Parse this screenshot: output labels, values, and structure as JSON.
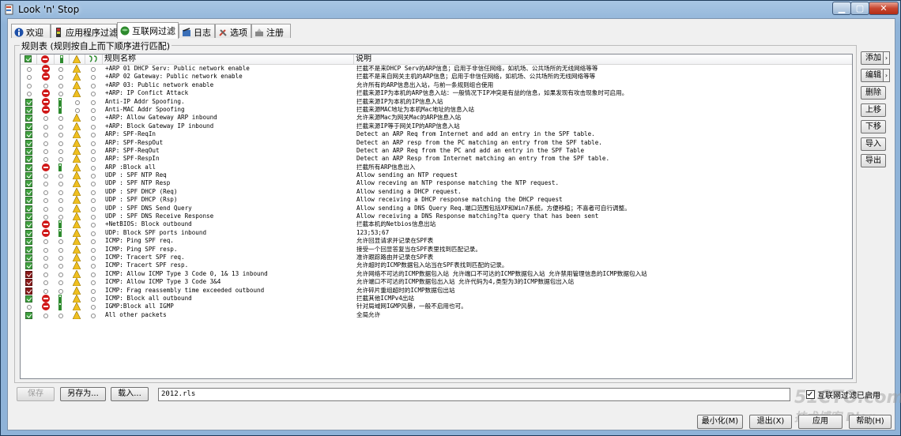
{
  "window": {
    "title": "Look 'n' Stop"
  },
  "tabs": [
    {
      "label": "欢迎",
      "icon": "info-icon"
    },
    {
      "label": "应用程序过滤",
      "icon": "filter-icon"
    },
    {
      "label": "互联网过滤",
      "icon": "globe-icon",
      "active": true
    },
    {
      "label": "日志",
      "icon": "log-icon"
    },
    {
      "label": "选项",
      "icon": "tools-icon"
    },
    {
      "label": "注册",
      "icon": "register-icon"
    }
  ],
  "group": {
    "label": "规则表 (规则按自上而下顺序进行匹配)"
  },
  "columns": {
    "name": "规则名称",
    "desc": "说明"
  },
  "rules": [
    {
      "name": "+ARP 01 DHCP Serv: Public network enable",
      "desc": "拦截不是来DHCP Serv的ARP信息；启用于非信任网络，如机场、公共场所的无线网络等等",
      "checked": false,
      "stop": true,
      "warn": true
    },
    {
      "name": "+ARP 02 Gateway: Public network enable",
      "desc": "拦截不是来自网关主机的ARP信息；启用于非信任网络，如机场、公共场所的无线网络等等",
      "checked": false,
      "stop": true,
      "warn": true
    },
    {
      "name": "+ARP 03: Public network enable",
      "desc": "允许所有的ARP信息出入站，与前一条规则组合使用",
      "checked": false,
      "stop": false,
      "warn": true
    },
    {
      "name": "+ARP: IP Confict Attack",
      "desc": "拦截来源IP为本机的ARP信息入站：一般情况下IP冲突是有益的信息，如果发现有攻击现象时可启用。",
      "checked": false,
      "stop": true,
      "warn": true
    },
    {
      "name": "Anti-IP Addr Spoofing.",
      "desc": "拦截来源IP为本机的IP信息入站",
      "checked": true,
      "stop": true,
      "warn": false
    },
    {
      "name": "Anti-MAC Addr Spoofing",
      "desc": "拦截来源MAC地址为本机Mac地址的信息入站",
      "checked": true,
      "stop": true,
      "warn": false
    },
    {
      "name": "+ARP: Allow Gateway ARP inbound",
      "desc": "允许来源Mac为网关Mac的ARP信息入站",
      "checked": true,
      "stop": false,
      "warn": true
    },
    {
      "name": "+ARP: Block Gateway IP inbound",
      "desc": "拦截来源IP等于网关IP的ARP信息入站",
      "checked": true,
      "stop": false,
      "warn": true
    },
    {
      "name": "ARP: SPF-ReqIn",
      "desc": "Detect an ARP Req from Internet and add an entry in the SPF table.",
      "checked": true,
      "stop": false,
      "warn": true
    },
    {
      "name": "ARP: SPF-RespOut",
      "desc": "Detect an ARP resp from the PC matching an entry from the SPF table.",
      "checked": true,
      "stop": false,
      "warn": true
    },
    {
      "name": "ARP: SPF-ReqOut",
      "desc": "Detect an ARP Req from the PC and add an entry in the SPF Table",
      "checked": true,
      "stop": false,
      "warn": true
    },
    {
      "name": "ARP: SPF-RespIn",
      "desc": "Detect an ARP Resp from Internet matching an entry from the SPF table.",
      "checked": true,
      "stop": false,
      "warn": true
    },
    {
      "name": "ARP :Block all",
      "desc": "拦截所有ARP信息出入",
      "checked": true,
      "stop": true,
      "warn": true
    },
    {
      "name": "UDP : SPF NTP Req",
      "desc": "Allow sending an NTP request",
      "checked": true,
      "stop": false,
      "warn": true
    },
    {
      "name": "UDP : SPF NTP Resp",
      "desc": "Allow receving an NTP response matching the NTP request.",
      "checked": true,
      "stop": false,
      "warn": true
    },
    {
      "name": "UDP : SPF DHCP (Req)",
      "desc": "Allow sending a DHCP request.",
      "checked": true,
      "stop": false,
      "warn": true
    },
    {
      "name": "UDP : SPF DHCP (Rsp)",
      "desc": "Allow receiving a DHCP response matching the DHCP request",
      "checked": true,
      "stop": false,
      "warn": true
    },
    {
      "name": "UDP : SPF DNS Send Query",
      "desc": "Allow sending a DNS Query Req.端口范围包括XP和Win7系统，方便移植；不喜者可自行调整。",
      "checked": true,
      "stop": false,
      "warn": true
    },
    {
      "name": "UDP : SPF DNS Receive Response",
      "desc": "Allow receiving a DNS Response matching?ta query that has been sent",
      "checked": true,
      "stop": false,
      "warn": true
    },
    {
      "name": "+NetBIOS: Block outbound",
      "desc": "拦截本机的Netbios信息出站",
      "checked": true,
      "stop": true,
      "warn": true
    },
    {
      "name": "UDP: Block SPF ports inbound",
      "desc": "123;53;67",
      "checked": true,
      "stop": true,
      "warn": true
    },
    {
      "name": "ICMP: Ping SPF req.",
      "desc": "允许回显请求并记录在SPF表",
      "checked": true,
      "stop": false,
      "warn": true
    },
    {
      "name": "ICMP: Ping SPF resp.",
      "desc": "接受一个回显答复当在SPF表里找到匹配记录。",
      "checked": true,
      "stop": false,
      "warn": true
    },
    {
      "name": "ICMP: Tracert SPF req.",
      "desc": "准许跟踪路由并记录在SPF表",
      "checked": true,
      "stop": false,
      "warn": true
    },
    {
      "name": "ICMP: Tracert SPF resp.",
      "desc": "允许超时的ICMP数据包入站当在SPF表找到匹配的记录。",
      "checked": true,
      "stop": false,
      "warn": true
    },
    {
      "name": "ICMP: Allow ICMP Type 3 Code 0, 1& 13 inbound",
      "desc": "允许网络不可达的ICMP数据包入站 允许端口不可达的ICMP数据包入站 允许禁用管理信息的ICMP数据包入站",
      "checked": true,
      "red": true,
      "stop": false,
      "warn": true
    },
    {
      "name": "ICMP: Allow ICMP Type 3 Code 3&4",
      "desc": "允许端口不可达的ICMP数据包出入站 允许代码为4,类型为3的ICMP数据包出入站",
      "checked": true,
      "red": true,
      "stop": false,
      "warn": true
    },
    {
      "name": "ICMP: Frag reassembly time exceeded outbound",
      "desc": "允许碎片重组超时的ICMP数据包出站",
      "checked": true,
      "red": true,
      "stop": false,
      "warn": true
    },
    {
      "name": "ICMP: Block all outbound",
      "desc": "拦截其他ICMPv4出站",
      "checked": true,
      "stop": true,
      "warn": true
    },
    {
      "name": "IGMP:Block all IGMP",
      "desc": "针对局域网IGMP风暴，一般不启用也可。",
      "checked": false,
      "stop": true,
      "warn": true
    },
    {
      "name": "All other packets",
      "desc": "全局允许",
      "checked": true,
      "stop": false,
      "warn": true
    }
  ],
  "side_buttons": {
    "add": "添加",
    "edit": "编辑",
    "delete": "删除",
    "up": "上移",
    "down": "下移",
    "import": "导入",
    "export": "导出"
  },
  "bottom": {
    "save": "保存",
    "save_as": "另存为...",
    "load": "载入...",
    "filename": "2012.rls",
    "enable_label": "互联网过滤已启用",
    "minimize": "最小化(M)",
    "exit": "退出(X)",
    "apply": "应用",
    "help": "帮助(H)"
  },
  "watermark": {
    "line1": "51CTO.com",
    "line2": "技术博客 Blog"
  }
}
